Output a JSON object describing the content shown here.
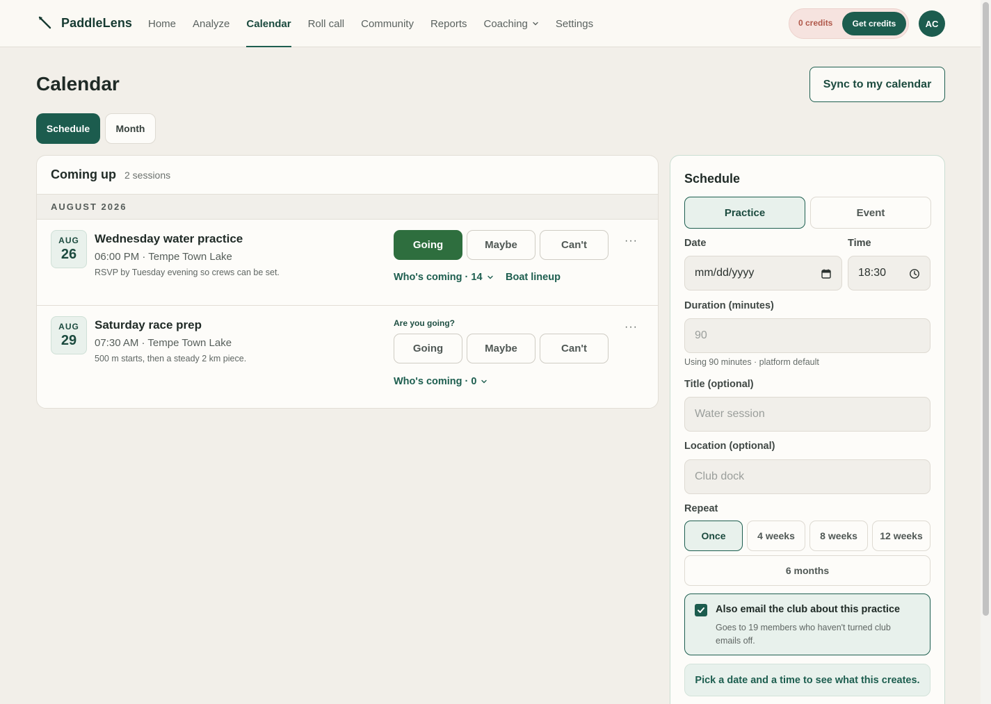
{
  "app": {
    "name": "PaddleLens",
    "logo_icon": "paddle-icon",
    "accent": "#1c5c4e"
  },
  "nav": {
    "items": [
      {
        "label": "Home"
      },
      {
        "label": "Analyze"
      },
      {
        "label": "Calendar",
        "active": true
      },
      {
        "label": "Roll call"
      },
      {
        "label": "Community"
      },
      {
        "label": "Reports"
      },
      {
        "label": "Coaching",
        "has_dropdown": true
      },
      {
        "label": "Settings"
      }
    ]
  },
  "account": {
    "credits_label": "0 credits",
    "get_credits_label": "Get credits",
    "avatar_initials": "AC"
  },
  "page": {
    "title": "Calendar",
    "sync_label": "Sync to my calendar",
    "view_tabs": [
      {
        "label": "Schedule",
        "active": true
      },
      {
        "label": "Month",
        "active": false
      }
    ]
  },
  "sessions": {
    "title": "Coming up",
    "count": "2 sessions",
    "month_label": "AUGUST 2026",
    "items": [
      {
        "month": "AUG",
        "day": "26",
        "title": "Wednesday water practice",
        "meta": "06:00 PM · Tempe Town Lake",
        "note": "RSVP by Tuesday evening so crews can be set.",
        "prompt": "",
        "rsvp": [
          "Going",
          "Maybe",
          "Can't"
        ],
        "selected_rsvp": "Going",
        "whos_coming": "Who's coming · 14",
        "lineup": "Boat lineup",
        "more": "···"
      },
      {
        "month": "AUG",
        "day": "29",
        "title": "Saturday race prep",
        "meta": "07:30 AM · Tempe Town Lake",
        "note": "500 m starts, then a steady 2 km piece.",
        "prompt": "Are you going?",
        "rsvp": [
          "Going",
          "Maybe",
          "Can't"
        ],
        "selected_rsvp": "",
        "whos_coming": "Who's coming · 0",
        "more": "···"
      }
    ]
  },
  "schedule": {
    "title": "Schedule",
    "types": [
      {
        "label": "Practice",
        "active": true
      },
      {
        "label": "Event",
        "active": false
      }
    ],
    "date_label": "Date",
    "date_placeholder": "mm/dd/yyyy",
    "time_label": "Time",
    "time_value": "18:30",
    "duration_label": "Duration (minutes)",
    "duration_placeholder": "90",
    "duration_hint": "Using 90 minutes · platform default",
    "title_label": "Title (optional)",
    "title_placeholder": "Water session",
    "location_label": "Location (optional)",
    "location_placeholder": "Club dock",
    "repeat_label": "Repeat",
    "repeat_options": [
      {
        "label": "Once",
        "active": true
      },
      {
        "label": "4 weeks"
      },
      {
        "label": "8 weeks"
      },
      {
        "label": "12 weeks"
      },
      {
        "label": "6 months"
      }
    ],
    "email": {
      "checked": true,
      "title": "Also email the club about this practice",
      "note": "Goes to 19 members who haven't turned club emails off."
    },
    "preview_text": "Pick a date and a time to see what this creates."
  }
}
